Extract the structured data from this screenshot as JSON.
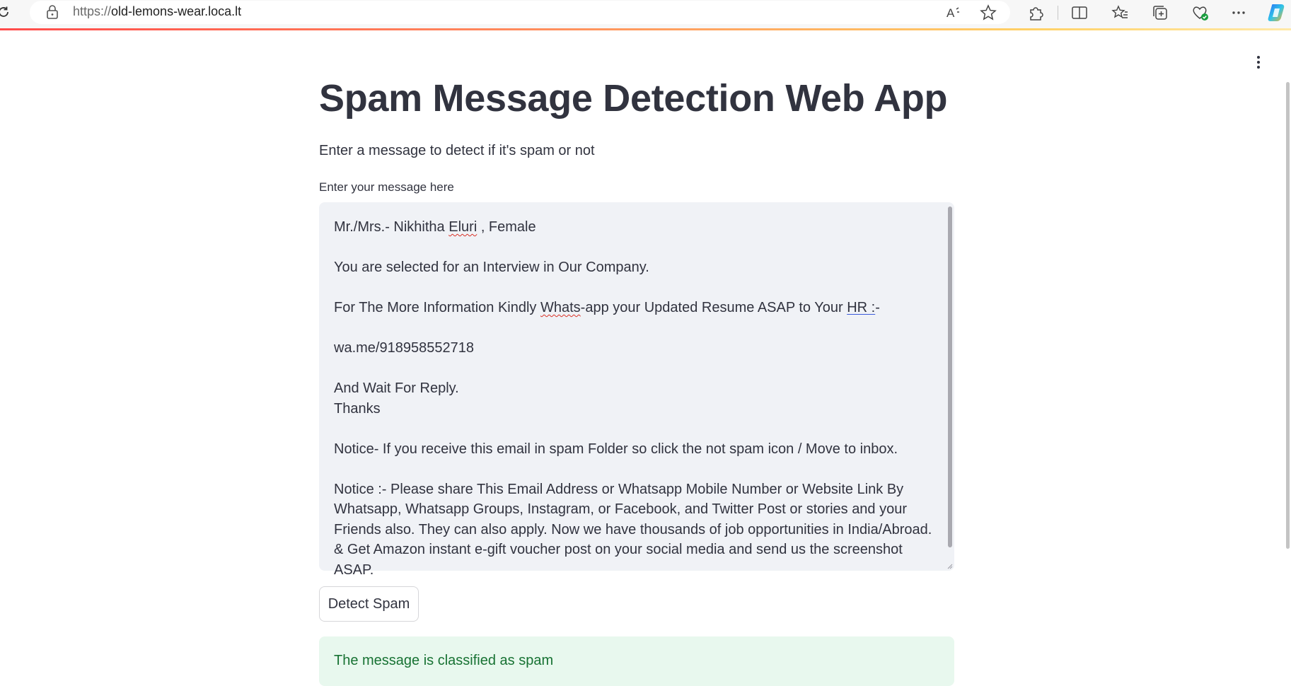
{
  "browser": {
    "url_protocol": "https://",
    "url_host": "old-lemons-wear.loca.lt",
    "icons": [
      "reload-icon",
      "lock-icon",
      "read-aloud-icon",
      "favorite-star-icon",
      "extensions-icon",
      "split-screen-icon",
      "favorites-icon",
      "collections-icon",
      "browser-essentials-icon",
      "more-icon",
      "copilot-icon"
    ]
  },
  "app": {
    "title": "Spam Message Detection Web App",
    "subtitle": "Enter a message to detect if it's spam or not",
    "input_label": "Enter your message here",
    "message": {
      "line1_pre": "Mr./Mrs.- Nikhitha ",
      "line1_squiggle": "Eluri",
      "line1_post": " , Female",
      "line2": "You are selected for an Interview in Our Company.",
      "line3_pre": "For The More Information Kindly ",
      "line3_squiggle": "Whats",
      "line3_mid": "-app your Updated Resume ASAP to Your ",
      "line3_underlined": "HR :",
      "line3_post": "-",
      "line4": "wa.me/918958552718",
      "line5": "And Wait For Reply.",
      "line6": "Thanks",
      "line7": "Notice- If you receive this email in spam Folder so click the not spam icon / Move to inbox.",
      "line8": "Notice :- Please share This Email Address or Whatsapp Mobile Number or Website Link By Whatsapp, Whatsapp Groups, Instagram, or Facebook, and Twitter Post or stories and your Friends also. They can also apply. Now we have thousands of job opportunities in India/Abroad. & Get Amazon instant e-gift voucher post on your social media and send us the screenshot ASAP."
    },
    "detect_button": "Detect Spam",
    "result": "The message is classified as spam"
  },
  "colors": {
    "text": "#31333f",
    "input_bg": "#f0f2f6",
    "success_bg": "#e8f8ee",
    "success_text": "#177233"
  }
}
